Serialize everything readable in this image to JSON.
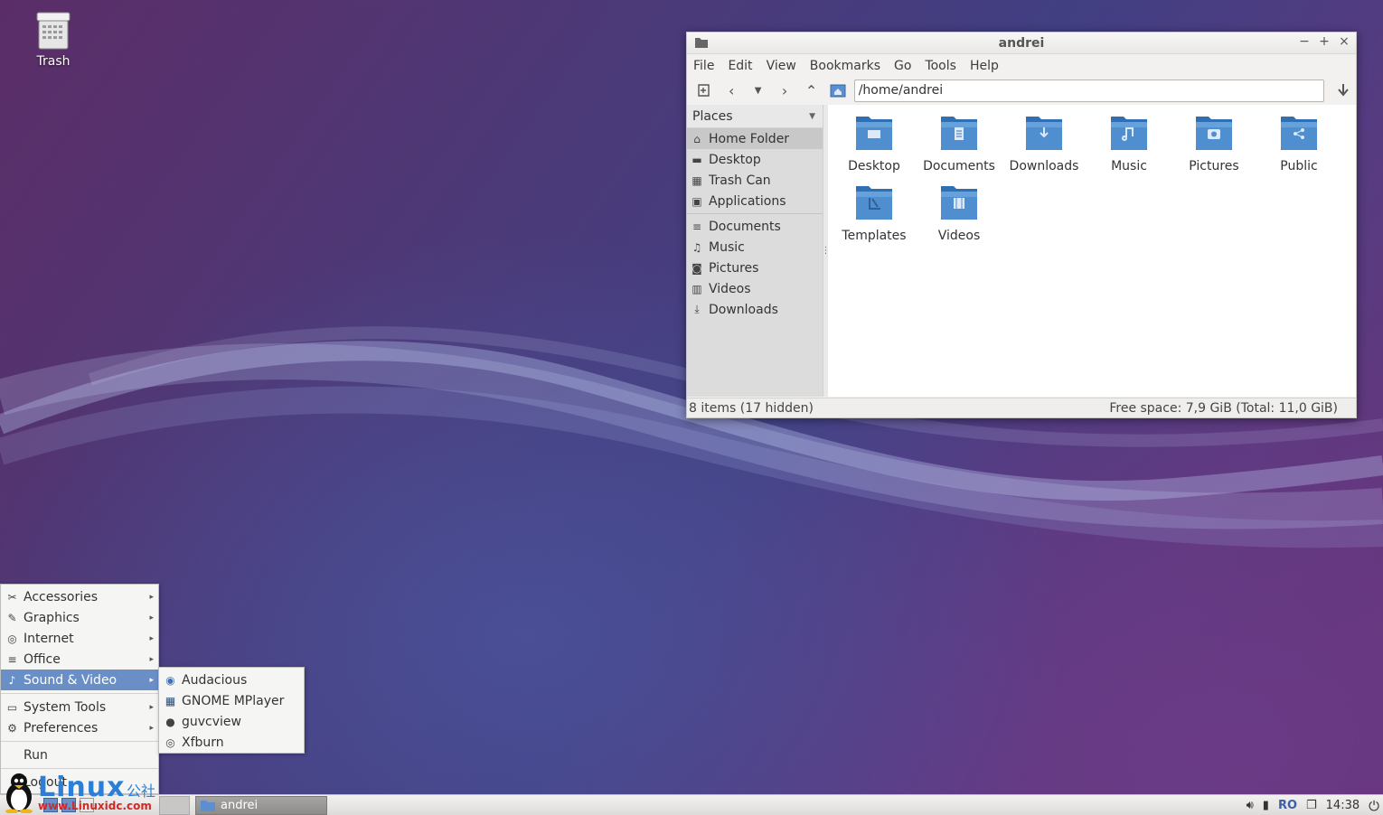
{
  "desktop": {
    "icons": [
      {
        "label": "Trash",
        "icon": "trash-icon"
      }
    ]
  },
  "window": {
    "title": "andrei",
    "controls": {
      "minimize": "−",
      "maximize": "+",
      "close": "×"
    },
    "menubar": [
      "File",
      "Edit",
      "View",
      "Bookmarks",
      "Go",
      "Tools",
      "Help"
    ],
    "path": "/home/andrei",
    "sidebar": {
      "header": "Places",
      "places": [
        {
          "label": "Home Folder",
          "icon": "home-icon",
          "active": true
        },
        {
          "label": "Desktop",
          "icon": "desktop-icon"
        },
        {
          "label": "Trash Can",
          "icon": "trash-icon"
        },
        {
          "label": "Applications",
          "icon": "applications-icon"
        }
      ],
      "bookmarks": [
        {
          "label": "Documents",
          "icon": "document-icon"
        },
        {
          "label": "Music",
          "icon": "music-icon"
        },
        {
          "label": "Pictures",
          "icon": "picture-icon"
        },
        {
          "label": "Videos",
          "icon": "video-icon"
        },
        {
          "label": "Downloads",
          "icon": "download-icon"
        }
      ]
    },
    "files": [
      {
        "label": "Desktop",
        "emblem": "desktop"
      },
      {
        "label": "Documents",
        "emblem": "document"
      },
      {
        "label": "Downloads",
        "emblem": "download"
      },
      {
        "label": "Music",
        "emblem": "music"
      },
      {
        "label": "Pictures",
        "emblem": "picture"
      },
      {
        "label": "Public",
        "emblem": "share"
      },
      {
        "label": "Templates",
        "emblem": "template"
      },
      {
        "label": "Videos",
        "emblem": "video"
      }
    ],
    "status_left": "8 items (17 hidden)",
    "status_right": "Free space: 7,9 GiB (Total: 11,0 GiB)"
  },
  "app_menu": {
    "items": [
      {
        "label": "Accessories",
        "icon": "accessories-icon",
        "submenu": true
      },
      {
        "label": "Graphics",
        "icon": "graphics-icon",
        "submenu": true
      },
      {
        "label": "Internet",
        "icon": "internet-icon",
        "submenu": true
      },
      {
        "label": "Office",
        "icon": "office-icon",
        "submenu": true
      },
      {
        "label": "Sound & Video",
        "icon": "multimedia-icon",
        "submenu": true,
        "active": true
      },
      {
        "label": "System Tools",
        "icon": "system-icon",
        "submenu": true
      },
      {
        "label": "Preferences",
        "icon": "preferences-icon",
        "submenu": true
      },
      {
        "label": "Run"
      },
      {
        "label": "Logout"
      }
    ],
    "submenu_items": [
      {
        "label": "Audacious",
        "icon": "audacious-icon"
      },
      {
        "label": "GNOME MPlayer",
        "icon": "mplayer-icon"
      },
      {
        "label": "guvcview",
        "icon": "webcam-icon"
      },
      {
        "label": "Xfburn",
        "icon": "disc-icon"
      }
    ]
  },
  "taskbar": {
    "task_label": "andrei",
    "keyboard_layout": "RO",
    "clock": "14:38"
  },
  "watermark": {
    "brand": "Linux",
    "brand_cn": "公社",
    "url": "www.Linuxidc.com"
  },
  "colors": {
    "accent": "#6a8fc7",
    "folder": "#4f8fd0"
  }
}
